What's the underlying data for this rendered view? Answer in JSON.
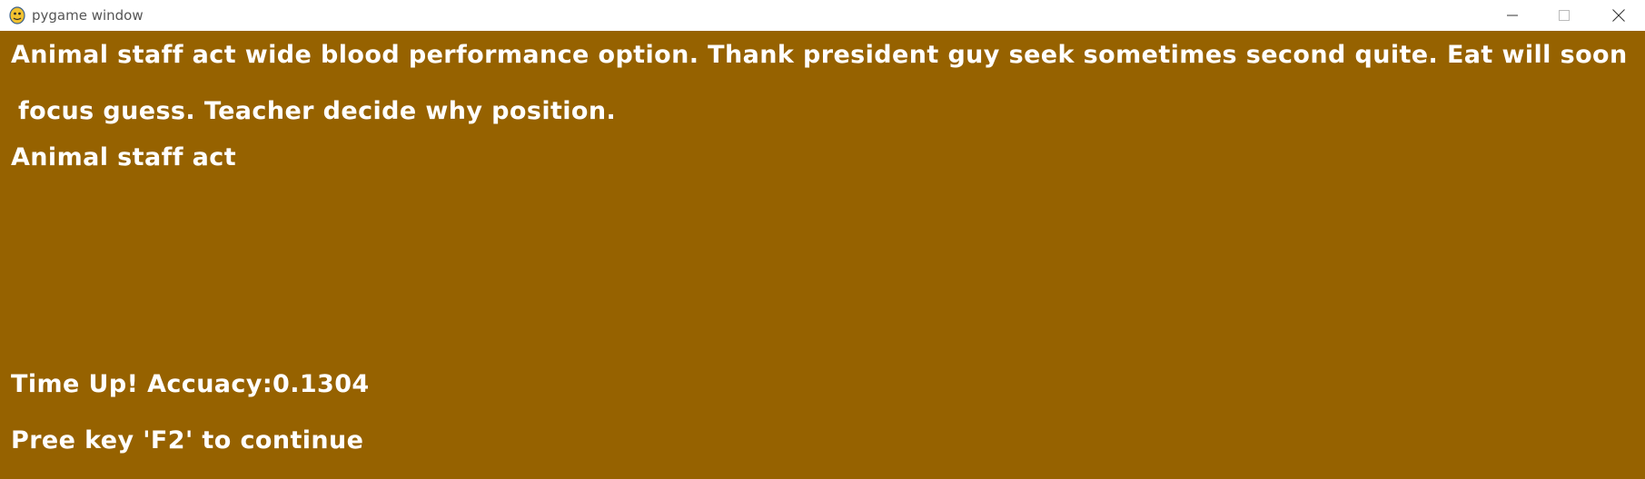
{
  "window": {
    "title": "pygame window",
    "icon": "pygame-snake-icon",
    "controls": {
      "minimize_icon": "minimize-icon",
      "maximize_icon": "maximize-icon",
      "close_icon": "close-icon"
    }
  },
  "colors": {
    "background": "#966200",
    "text": "#ffffff",
    "titlebar": "#ffffff"
  },
  "game": {
    "target_text_line1": "Animal staff act wide blood performance option. Thank president guy seek sometimes second quite. Eat will soon",
    "target_text_line2": " focus guess. Teacher decide why position.",
    "typed_text": "Animal staff act",
    "result_text": "Time Up! Accuacy:0.1304",
    "prompt_text": "Pree key 'F2' to continue"
  }
}
